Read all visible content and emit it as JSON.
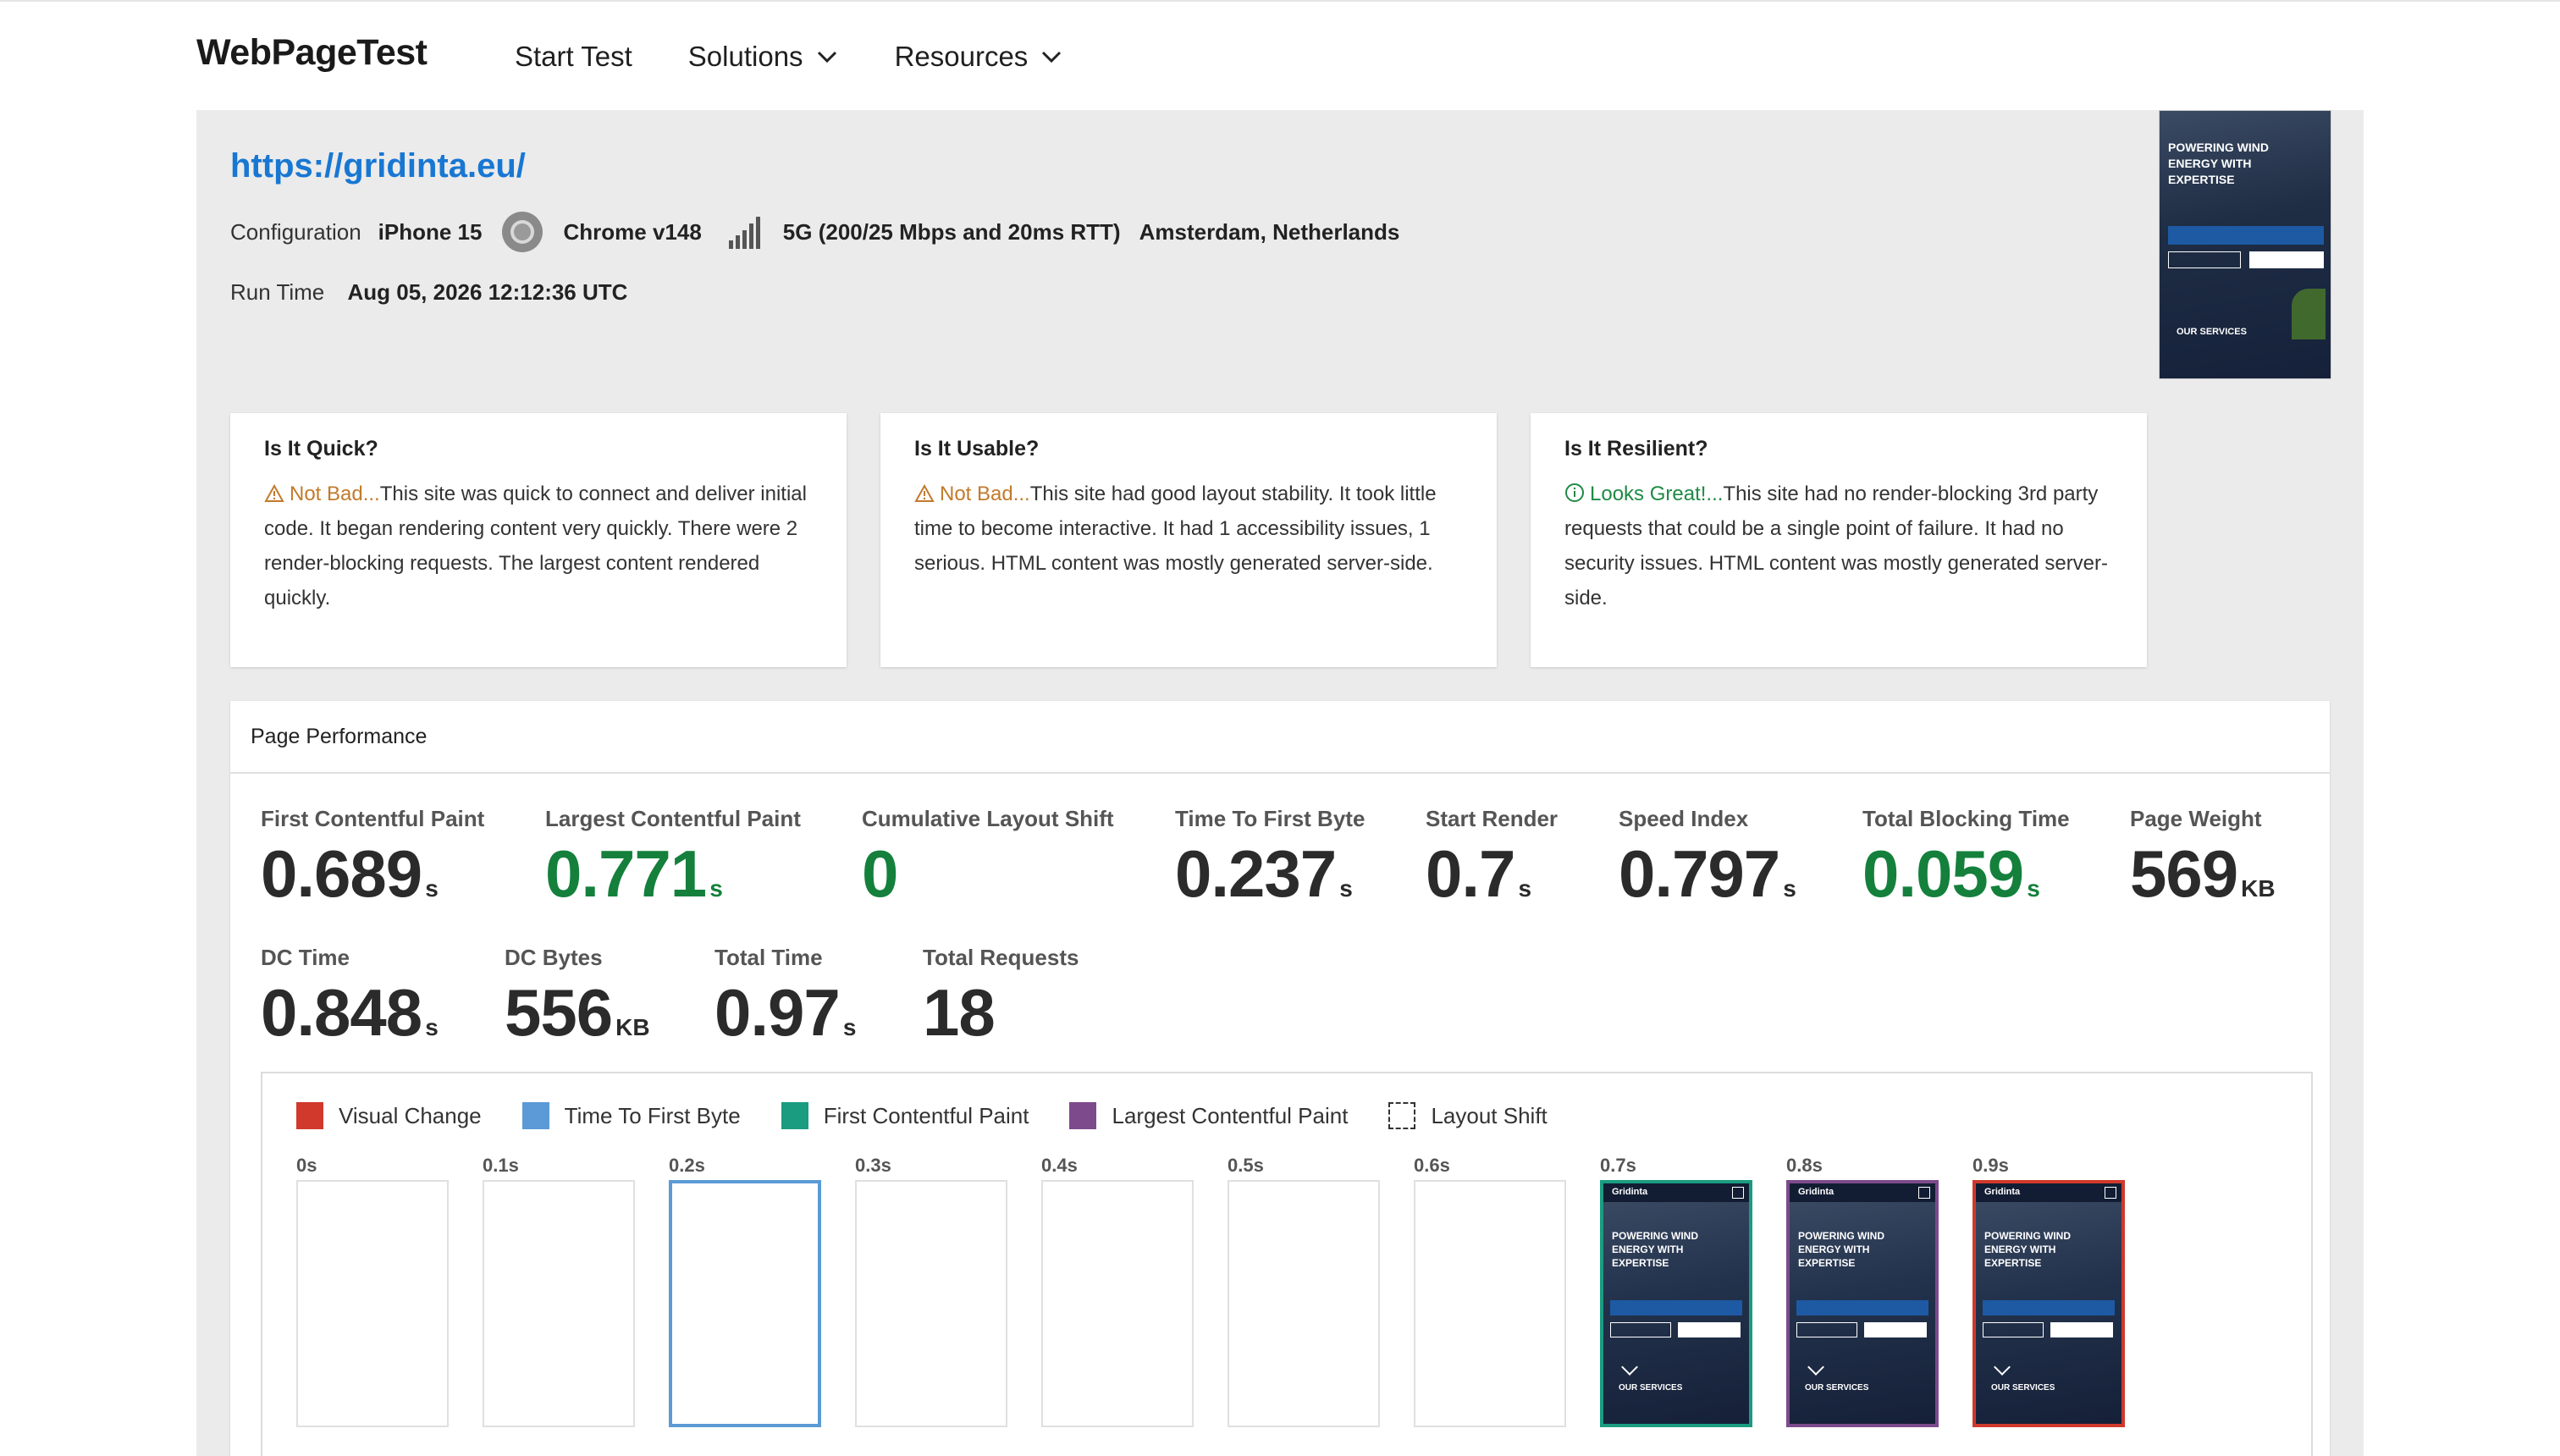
{
  "header": {
    "logo": "WebPageTest",
    "nav": [
      {
        "label": "Start Test",
        "dropdown": false
      },
      {
        "label": "Solutions",
        "dropdown": true
      },
      {
        "label": "Resources",
        "dropdown": true
      }
    ]
  },
  "test": {
    "url": "https://gridinta.eu/",
    "config_label": "Configuration",
    "device": "iPhone 15",
    "browser": "Chrome v148",
    "connection": "5G (200/25 Mbps and 20ms RTT)",
    "location": "Amsterdam, Netherlands",
    "runtime_label": "Run Time",
    "runtime": "Aug 05, 2026 12:12:36 UTC"
  },
  "thumbnail": {
    "headline": "POWERING WIND ENERGY WITH EXPERTISE",
    "section": "OUR SERVICES"
  },
  "cards": [
    {
      "title": "Is It Quick?",
      "status": "Not Bad...",
      "status_type": "warn",
      "text": "This site was quick to connect and deliver initial code. It began rendering content very quickly. There were 2 render-blocking requests. The largest content rendered quickly."
    },
    {
      "title": "Is It Usable?",
      "status": "Not Bad...",
      "status_type": "warn",
      "text": "This site had good layout stability. It took little time to become interactive. It had 1 accessibility issues, 1 serious. HTML content was mostly generated server-side."
    },
    {
      "title": "Is It Resilient?",
      "status": "Looks Great!...",
      "status_type": "good",
      "text": "This site had no render-blocking 3rd party requests that could be a single point of failure. It had no security issues. HTML content was mostly generated server-side."
    }
  ],
  "performance": {
    "title": "Page Performance",
    "metrics": [
      {
        "label": "First Contentful Paint",
        "value": "0.689",
        "unit": "s",
        "good": false
      },
      {
        "label": "Largest Contentful Paint",
        "value": "0.771",
        "unit": "s",
        "good": true
      },
      {
        "label": "Cumulative Layout Shift",
        "value": "0",
        "unit": "",
        "good": true
      },
      {
        "label": "Time To First Byte",
        "value": "0.237",
        "unit": "s",
        "good": false
      },
      {
        "label": "Start Render",
        "value": "0.7",
        "unit": "s",
        "good": false
      },
      {
        "label": "Speed Index",
        "value": "0.797",
        "unit": "s",
        "good": false
      },
      {
        "label": "Total Blocking Time",
        "value": "0.059",
        "unit": "s",
        "good": true
      },
      {
        "label": "Page Weight",
        "value": "569",
        "unit": "KB",
        "good": false
      },
      {
        "label": "DC Time",
        "value": "0.848",
        "unit": "s",
        "good": false
      },
      {
        "label": "DC Bytes",
        "value": "556",
        "unit": "KB",
        "good": false
      },
      {
        "label": "Total Time",
        "value": "0.97",
        "unit": "s",
        "good": false
      },
      {
        "label": "Total Requests",
        "value": "18",
        "unit": "",
        "good": false
      }
    ]
  },
  "filmstrip": {
    "legend": [
      {
        "label": "Visual Change",
        "color": "#d0392b"
      },
      {
        "label": "Time To First Byte",
        "color": "#5b9ad6"
      },
      {
        "label": "First Contentful Paint",
        "color": "#1a9c80"
      },
      {
        "label": "Largest Contentful Paint",
        "color": "#7d4a8c"
      },
      {
        "label": "Layout Shift",
        "color": "dashed"
      }
    ],
    "frames": [
      {
        "time": "0s",
        "style": "blank"
      },
      {
        "time": "0.1s",
        "style": "blank"
      },
      {
        "time": "0.2s",
        "style": "sel"
      },
      {
        "time": "0.3s",
        "style": "blank"
      },
      {
        "time": "0.4s",
        "style": "blank"
      },
      {
        "time": "0.5s",
        "style": "blank"
      },
      {
        "time": "0.6s",
        "style": "blank"
      },
      {
        "time": "0.7s",
        "style": "teal"
      },
      {
        "time": "0.8s",
        "style": "purple"
      },
      {
        "time": "0.9s",
        "style": "red"
      }
    ],
    "shot_brand": "Gridinta",
    "shot_headline": "POWERING WIND ENERGY WITH EXPERTISE",
    "shot_section": "OUR SERVICES"
  }
}
